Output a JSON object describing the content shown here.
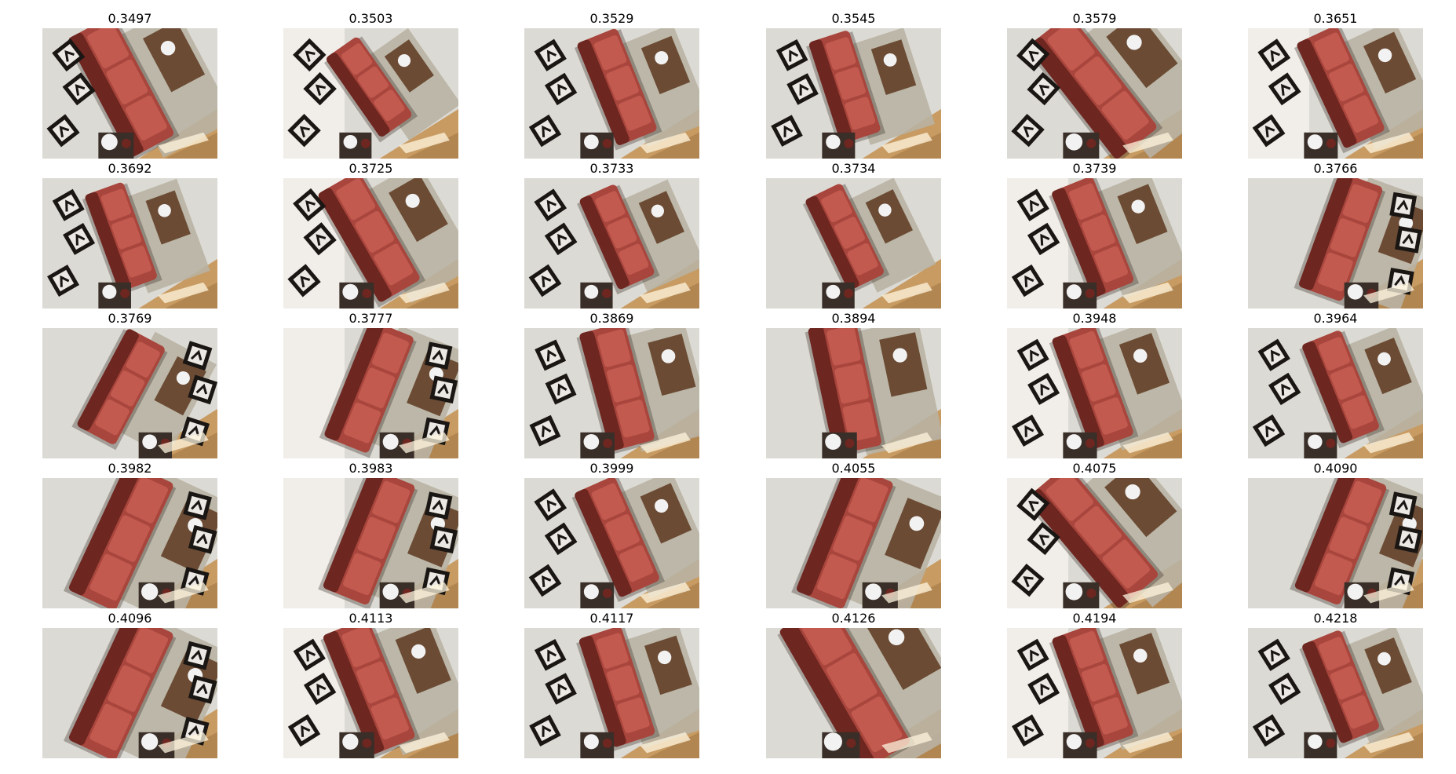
{
  "figure": {
    "rows": 5,
    "cols": 6,
    "scene_palette": {
      "sofa": "#a8453c",
      "sofa_dark": "#6e2620",
      "sofa_light": "#c25a4f",
      "carpet": "#dcdad4",
      "rug": "#b8b2a3",
      "wood_floor": "#c89b62",
      "wood_floor_dark": "#8a5f33",
      "frame": "#1a1614",
      "frame_inner": "#ece9e4",
      "table": "#6b4b34",
      "vase": "#f2f2f2",
      "shadow": "#3a2e28",
      "wall_bright": "#f4f1ec"
    },
    "cells": [
      {
        "title": "0.3497",
        "image": "room-render-thumbnail"
      },
      {
        "title": "0.3503",
        "image": "room-render-thumbnail"
      },
      {
        "title": "0.3529",
        "image": "room-render-thumbnail"
      },
      {
        "title": "0.3545",
        "image": "room-render-thumbnail"
      },
      {
        "title": "0.3579",
        "image": "room-render-thumbnail"
      },
      {
        "title": "0.3651",
        "image": "room-render-thumbnail"
      },
      {
        "title": "0.3692",
        "image": "room-render-thumbnail"
      },
      {
        "title": "0.3725",
        "image": "room-render-thumbnail"
      },
      {
        "title": "0.3733",
        "image": "room-render-thumbnail"
      },
      {
        "title": "0.3734",
        "image": "room-render-thumbnail"
      },
      {
        "title": "0.3739",
        "image": "room-render-thumbnail"
      },
      {
        "title": "0.3766",
        "image": "room-render-thumbnail"
      },
      {
        "title": "0.3769",
        "image": "room-render-thumbnail"
      },
      {
        "title": "0.3777",
        "image": "room-render-thumbnail"
      },
      {
        "title": "0.3869",
        "image": "room-render-thumbnail"
      },
      {
        "title": "0.3894",
        "image": "room-render-thumbnail"
      },
      {
        "title": "0.3948",
        "image": "room-render-thumbnail"
      },
      {
        "title": "0.3964",
        "image": "room-render-thumbnail"
      },
      {
        "title": "0.3982",
        "image": "room-render-thumbnail"
      },
      {
        "title": "0.3983",
        "image": "room-render-thumbnail"
      },
      {
        "title": "0.3999",
        "image": "room-render-thumbnail"
      },
      {
        "title": "0.4055",
        "image": "room-render-thumbnail"
      },
      {
        "title": "0.4075",
        "image": "room-render-thumbnail"
      },
      {
        "title": "0.4090",
        "image": "room-render-thumbnail"
      },
      {
        "title": "0.4096",
        "image": "room-render-thumbnail"
      },
      {
        "title": "0.4113",
        "image": "room-render-thumbnail"
      },
      {
        "title": "0.4117",
        "image": "room-render-thumbnail"
      },
      {
        "title": "0.4126",
        "image": "room-render-thumbnail"
      },
      {
        "title": "0.4194",
        "image": "room-render-thumbnail"
      },
      {
        "title": "0.4218",
        "image": "room-render-thumbnail"
      }
    ]
  }
}
